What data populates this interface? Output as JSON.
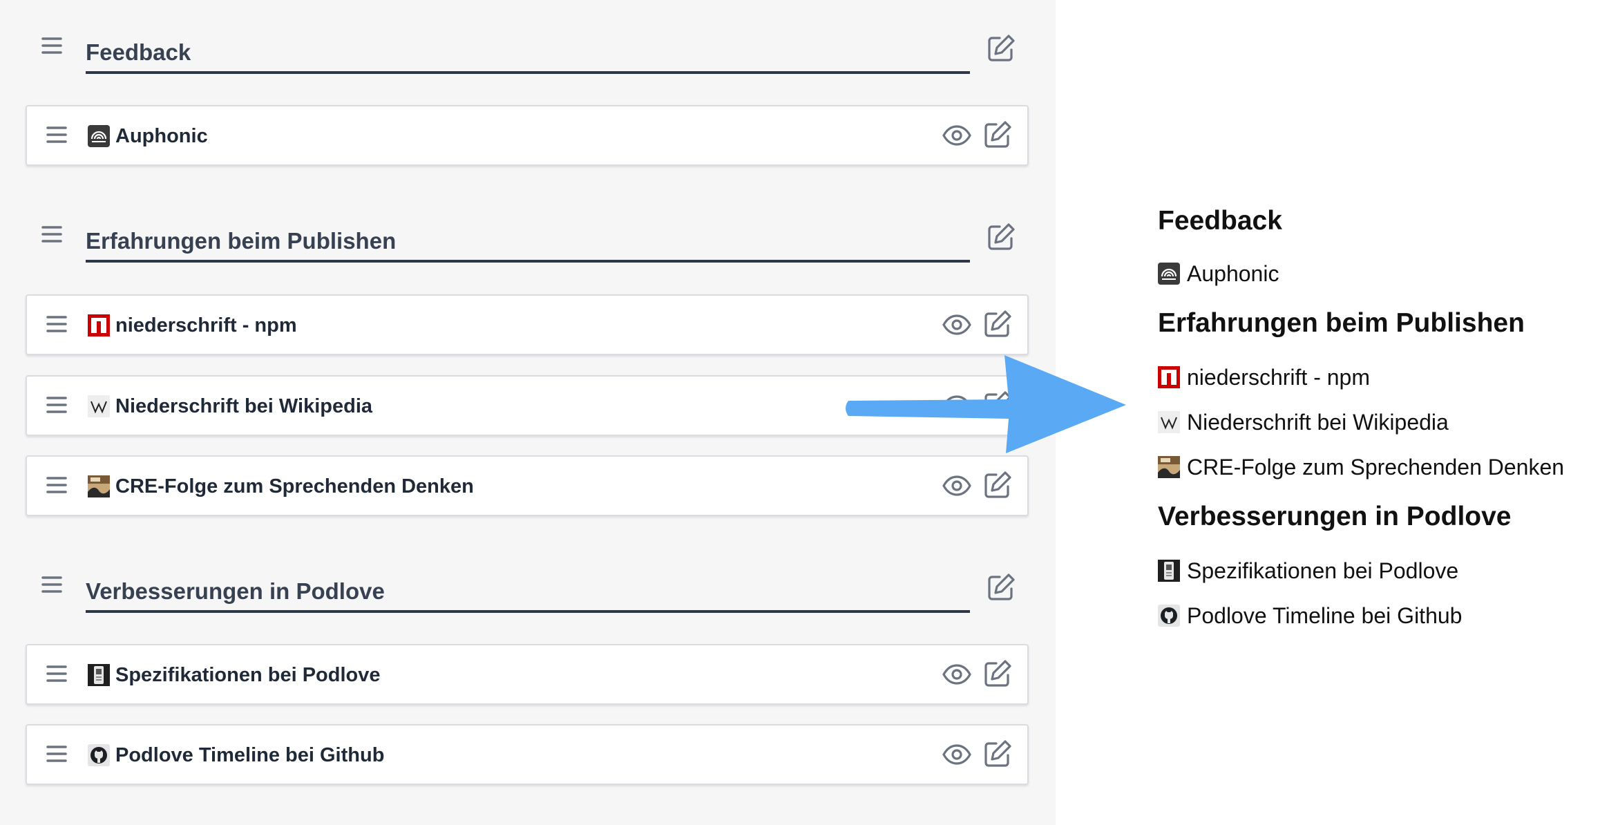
{
  "editor": {
    "sections": [
      {
        "title": "Feedback",
        "items": [
          {
            "label": "Auphonic",
            "icon": "auphonic-favicon"
          }
        ]
      },
      {
        "title": "Erfahrungen beim Publishen",
        "items": [
          {
            "label": "niederschrift - npm",
            "icon": "npm-favicon"
          },
          {
            "label": "Niederschrift bei Wikipedia",
            "icon": "wikipedia-favicon"
          },
          {
            "label": "CRE-Folge zum Sprechenden Denken",
            "icon": "cre-favicon"
          }
        ]
      },
      {
        "title": "Verbesserungen in Podlove",
        "items": [
          {
            "label": "Spezifikationen bei Podlove",
            "icon": "podlove-favicon"
          },
          {
            "label": "Podlove Timeline bei Github",
            "icon": "github-favicon"
          }
        ]
      }
    ]
  },
  "preview": {
    "sections": [
      {
        "title": "Feedback",
        "items": [
          "Auphonic"
        ]
      },
      {
        "title": "Erfahrungen beim Publishen",
        "items": [
          "niederschrift - npm",
          "Niederschrift bei Wikipedia",
          "CRE-Folge zum Sprechenden Denken"
        ]
      },
      {
        "title": "Verbesserungen in Podlove",
        "items": [
          "Spezifikationen bei Podlove",
          "Podlove Timeline bei Github"
        ]
      }
    ]
  },
  "colors": {
    "editor_bg": "#f6f6f7",
    "heading_underline": "#2d3748",
    "arrow": "#5aa9f5",
    "icon_gray": "#6b7280"
  },
  "icons": {
    "drag": "drag-handle-icon",
    "eye": "eye-icon",
    "edit": "edit-icon"
  }
}
